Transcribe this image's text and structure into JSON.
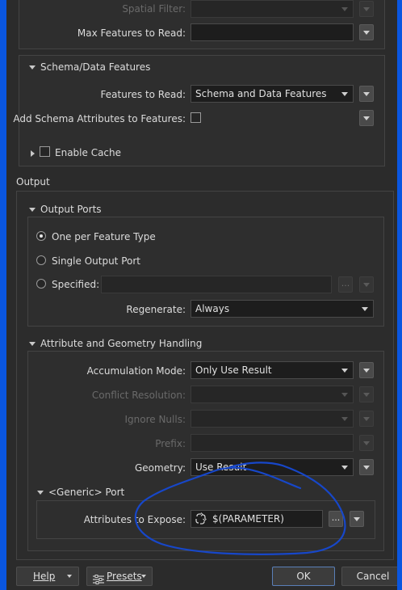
{
  "input": {
    "spatial_filter_label": "Spatial Filter:",
    "max_features_label": "Max Features to Read:",
    "max_features_value": ""
  },
  "schema": {
    "title": "Schema/Data Features",
    "features_to_read_label": "Features to Read:",
    "features_to_read_value": "Schema and Data Features",
    "add_schema_attrs_label": "Add Schema Attributes to Features:",
    "enable_cache_label": "Enable Cache"
  },
  "output": {
    "title": "Output",
    "ports": {
      "title": "Output Ports",
      "one_per_feature_type": "One per Feature Type",
      "single_output_port": "Single Output Port",
      "specified": "Specified:",
      "specified_value": "",
      "regenerate_label": "Regenerate:",
      "regenerate_value": "Always",
      "ellipsis": "..."
    },
    "attr_geom": {
      "title": "Attribute and Geometry Handling",
      "accumulation_mode_label": "Accumulation Mode:",
      "accumulation_mode_value": "Only Use Result",
      "conflict_resolution_label": "Conflict Resolution:",
      "ignore_nulls_label": "Ignore Nulls:",
      "prefix_label": "Prefix:",
      "geometry_label": "Geometry:",
      "geometry_value": "Use Result"
    },
    "generic_port": {
      "title": "<Generic> Port",
      "attributes_to_expose_label": "Attributes to Expose:",
      "attributes_to_expose_value": "$(PARAMETER)",
      "ellipsis": "..."
    }
  },
  "footer": {
    "help": "Help",
    "presets": "Presets",
    "ok": "OK",
    "cancel": "Cancel"
  },
  "colors": {
    "background": "#2b2b2b",
    "annotation": "#1747c9",
    "screen_border": "#0a56e0"
  }
}
